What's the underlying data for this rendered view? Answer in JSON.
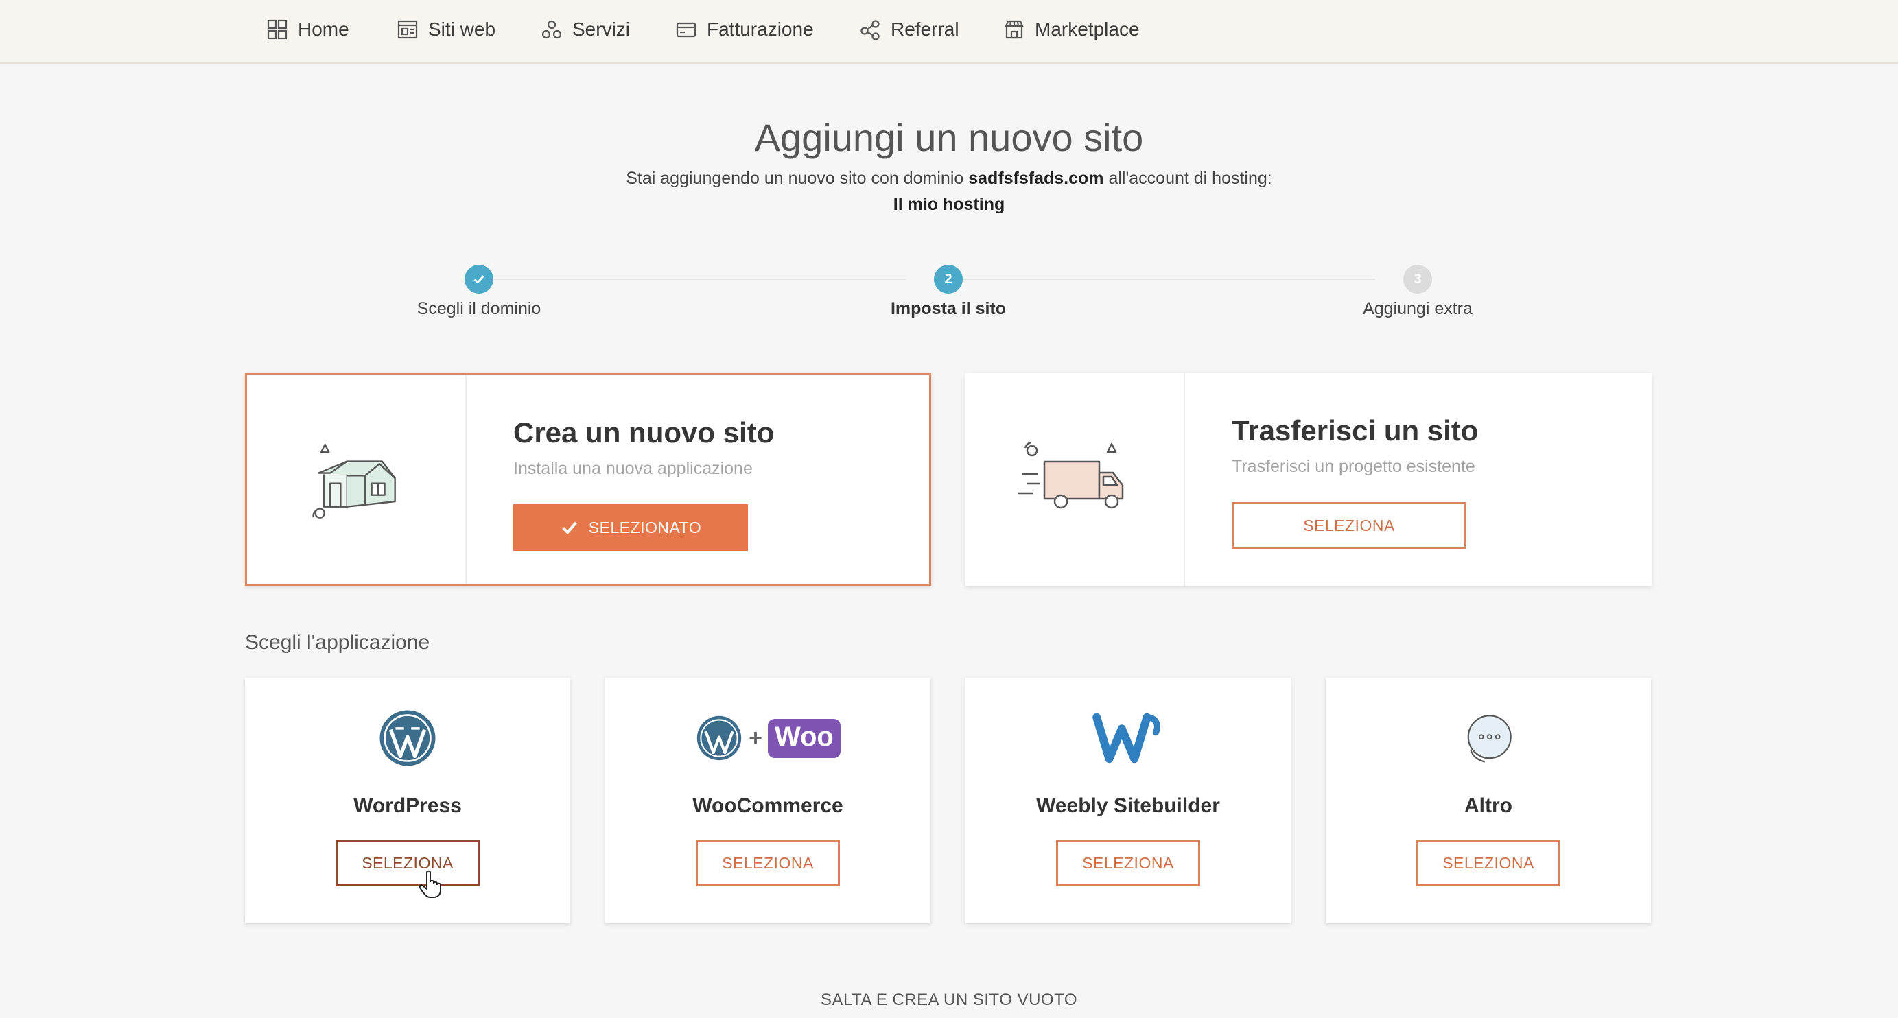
{
  "nav": {
    "items": [
      {
        "label": "Home",
        "icon": "grid-icon"
      },
      {
        "label": "Siti web",
        "icon": "browser-icon"
      },
      {
        "label": "Servizi",
        "icon": "services-icon"
      },
      {
        "label": "Fatturazione",
        "icon": "card-icon"
      },
      {
        "label": "Referral",
        "icon": "share-icon"
      },
      {
        "label": "Marketplace",
        "icon": "store-icon"
      }
    ]
  },
  "header": {
    "title": "Aggiungi un nuovo sito",
    "subtitle_before": "Stai aggiungendo un nuovo sito con dominio ",
    "domain": "sadfsfsfads.com",
    "subtitle_after": " all'account di hosting:",
    "hosting": "Il mio hosting"
  },
  "steps": [
    {
      "number": "1",
      "label": "Scegli il dominio",
      "state": "done"
    },
    {
      "number": "2",
      "label": "Imposta il sito",
      "state": "active"
    },
    {
      "number": "3",
      "label": "Aggiungi extra",
      "state": "pending"
    }
  ],
  "options": {
    "create": {
      "title": "Crea un nuovo sito",
      "description": "Installa una nuova applicazione",
      "button": "SELEZIONATO"
    },
    "transfer": {
      "title": "Trasferisci un sito",
      "description": "Trasferisci un progetto esistente",
      "button": "SELEZIONA"
    }
  },
  "apps": {
    "heading": "Scegli l'applicazione",
    "items": [
      {
        "name": "WordPress",
        "button": "SELEZIONA"
      },
      {
        "name": "WooCommerce",
        "button": "SELEZIONA",
        "logo_text": "Woo"
      },
      {
        "name": "Weebly Sitebuilder",
        "button": "SELEZIONA"
      },
      {
        "name": "Altro",
        "button": "SELEZIONA"
      }
    ]
  },
  "footer": {
    "skip": "SALTA E CREA UN SITO VUOTO"
  },
  "colors": {
    "accent": "#e5774a",
    "step": "#4aa9c9",
    "nav_bg": "#f8f4ef",
    "wordpress": "#3d6d8c",
    "woo": "#7f54b3",
    "weebly": "#2f7fc1"
  }
}
